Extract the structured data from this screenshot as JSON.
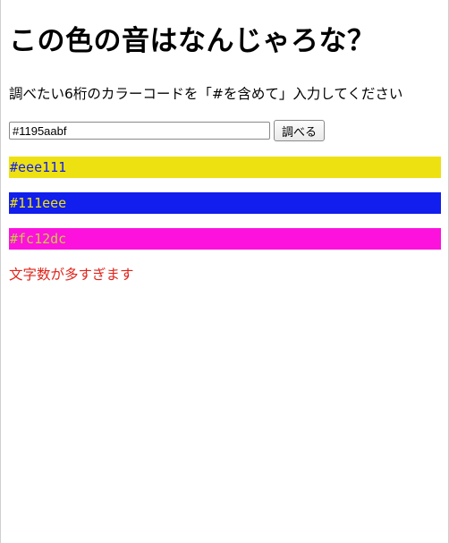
{
  "page": {
    "title": "この色の音はなんじゃろな？",
    "instruction": "調べたい6桁のカラーコードを「#を含めて」入力してください"
  },
  "form": {
    "input_value": "#1195aabf",
    "button_label": "調べる"
  },
  "swatches": [
    {
      "label": "#eee111",
      "background": "#eee111",
      "text_color": "#111eee"
    },
    {
      "label": "#111eee",
      "background": "#111eee",
      "text_color": "#eee111"
    },
    {
      "label": "#fc12dc",
      "background": "#fc12dc",
      "text_color": "#c0d040"
    }
  ],
  "error": {
    "message": "文字数が多すぎます",
    "color": "#e0241b"
  }
}
